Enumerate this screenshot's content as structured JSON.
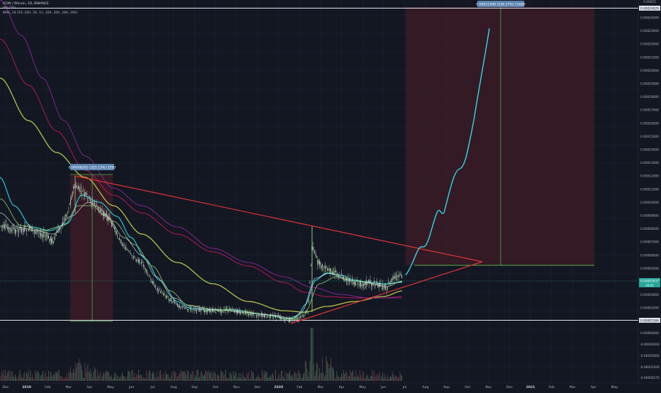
{
  "header": {
    "symbol_line": "ICON / Bitcoin, 1D, BINANCE",
    "vol_line": "Vol (20)",
    "indicator_line": "BMA_18 (50, 200, 20, 11, 100, 200, 280, 200)"
  },
  "price_axis": {
    "ticks": [
      "0.00024000",
      "0.00023000",
      "0.00022000",
      "0.00021000",
      "0.00020000",
      "0.00019000",
      "0.00018000",
      "0.00017000",
      "0.00016000",
      "0.00015000",
      "0.00014000",
      "0.00013000",
      "0.00012000",
      "0.00011000",
      "0.00010000",
      "0.00009000",
      "0.00008000",
      "0.00007000",
      "0.00006000",
      "0.00005000",
      "0.00004000",
      "0.00003000",
      "0.00002000"
    ],
    "top_label": "0.00025",
    "current_price_label": "0.00003437",
    "current_price_sub": "16:51",
    "high_level_label": "0.00024929",
    "low_level_label": "0.00001584",
    "accent_color": "#5b9cf6"
  },
  "volume_axis": {
    "ticks": [
      "0.00000000",
      "-0.00000500",
      "-0.00001000",
      "-0.00001500"
    ],
    "bottom_label": "-0.00000270"
  },
  "time_axis": {
    "labels": [
      "Dec",
      "2019",
      "Feb",
      "Mar",
      "Apr",
      "May",
      "Jun",
      "Jul",
      "Aug",
      "Sep",
      "Oct",
      "Nov",
      "Dec",
      "2020",
      "Feb",
      "Mar",
      "Apr",
      "May",
      "Jun",
      "Jul",
      "Aug",
      "Sep",
      "Oct",
      "Nov",
      "Dec",
      "2021",
      "Feb",
      "Mar",
      "Apr",
      "May"
    ]
  },
  "annotations": {
    "past_measure": "0.00008201 (325.23%) 3293",
    "future_measure": "0.00021948 (536.57%) 11688"
  },
  "colors": {
    "background": "#131722",
    "up_candle": "#a8d59a",
    "down_candle": "#c9cfd4",
    "trendline": "#e03535",
    "projection": "#33d9e8",
    "ma_cyan": "#26c6da",
    "ma_olive": "#b7c24a",
    "ma_pink": "#c2185b",
    "ma_magenta": "#9c27b0",
    "range_box": "#5a1f2a",
    "horizontal_level": "#dfe3ea",
    "target_line": "#4caf50"
  }
}
